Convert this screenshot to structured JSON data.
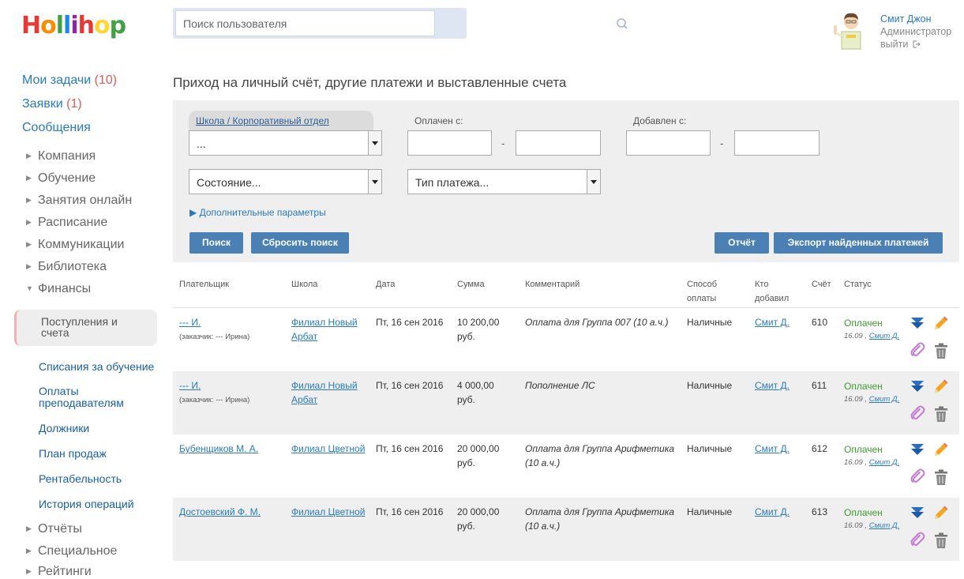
{
  "header": {
    "logo": "Hollihop",
    "search_placeholder": "Поиск пользователя",
    "user_name": "Смит Джон",
    "user_role": "Администратор",
    "logout": "выйти"
  },
  "sidebar": {
    "top": [
      {
        "label": "Мои задачи",
        "count": "(10)"
      },
      {
        "label": "Заявки",
        "count": "(1)"
      },
      {
        "label": "Сообщения",
        "count": ""
      }
    ],
    "sections": [
      "Компания",
      "Обучение",
      "Занятия онлайн",
      "Расписание",
      "Коммуникации",
      "Библиотека",
      "Финансы"
    ],
    "active": "Поступления и счета",
    "finance_items": [
      "Списания за обучение",
      "Оплаты преподавателям",
      "Должники",
      "План продаж",
      "Рентабельность",
      "История операций"
    ],
    "bottom": [
      "Отчёты",
      "Специальное",
      "Рейтинги"
    ]
  },
  "page": {
    "title": "Приход на личный счёт, другие платежи и выставленные счета"
  },
  "filters": {
    "school_tab": "Школа / Корпоративный отдел",
    "school_value": "...",
    "paid_from_label": "Оплачен с:",
    "added_from_label": "Добавлен с:",
    "dash": "-",
    "state_value": "Состояние...",
    "type_value": "Тип платежа...",
    "more_params": "▶ Дополнительные параметры",
    "search_btn": "Поиск",
    "reset_btn": "Сбросить поиск",
    "report_btn": "Отчёт",
    "export_btn": "Экспорт найденных платежей"
  },
  "table": {
    "columns": [
      "Плательщик",
      "Школа",
      "Дата",
      "Сумма",
      "Комментарий",
      "Способ оплаты",
      "Кто добавил",
      "Счёт",
      "Статус"
    ],
    "rows": [
      {
        "payer": "--- И.",
        "customer": "(заказчик: --- Ирина)",
        "school": "Филиал Новый Арбат",
        "date": "Пт, 16 сен 2016",
        "sum": "10 200,00 руб.",
        "comment": "Оплата для Группа 007 (10 а.ч.)",
        "method": "Наличные",
        "added_by": "Смит Д.",
        "account": "610",
        "status": "Оплачен",
        "status_date": "16.09 ,",
        "status_by": "Смит Д."
      },
      {
        "payer": "--- И.",
        "customer": "(заказчик: --- Ирина)",
        "school": "Филиал Новый Арбат",
        "date": "Пт, 16 сен 2016",
        "sum": "4 000,00 руб.",
        "comment": "Пополнение ЛС",
        "method": "Наличные",
        "added_by": "Смит Д.",
        "account": "611",
        "status": "Оплачен",
        "status_date": "16.09 ,",
        "status_by": "Смит Д."
      },
      {
        "payer": "Бубенщиков М. А.",
        "customer": "",
        "school": "Филиал Цветной",
        "date": "Пт, 16 сен 2016",
        "sum": "20 000,00 руб.",
        "comment": "Оплата для Группа Арифметика (10 а.ч.)",
        "method": "Наличные",
        "added_by": "Смит Д.",
        "account": "612",
        "status": "Оплачен",
        "status_date": "16.09 ,",
        "status_by": "Смит Д."
      },
      {
        "payer": "Достоевский Ф. М.",
        "customer": "",
        "school": "Филиал Цветной",
        "date": "Пт, 16 сен 2016",
        "sum": "20 000,00 руб.",
        "comment": "Оплата для Группа Арифметика (10 а.ч.)",
        "method": "Наличные",
        "added_by": "Смит Д.",
        "account": "613",
        "status": "Оплачен",
        "status_date": "16.09 ,",
        "status_by": "Смит Д."
      }
    ]
  }
}
